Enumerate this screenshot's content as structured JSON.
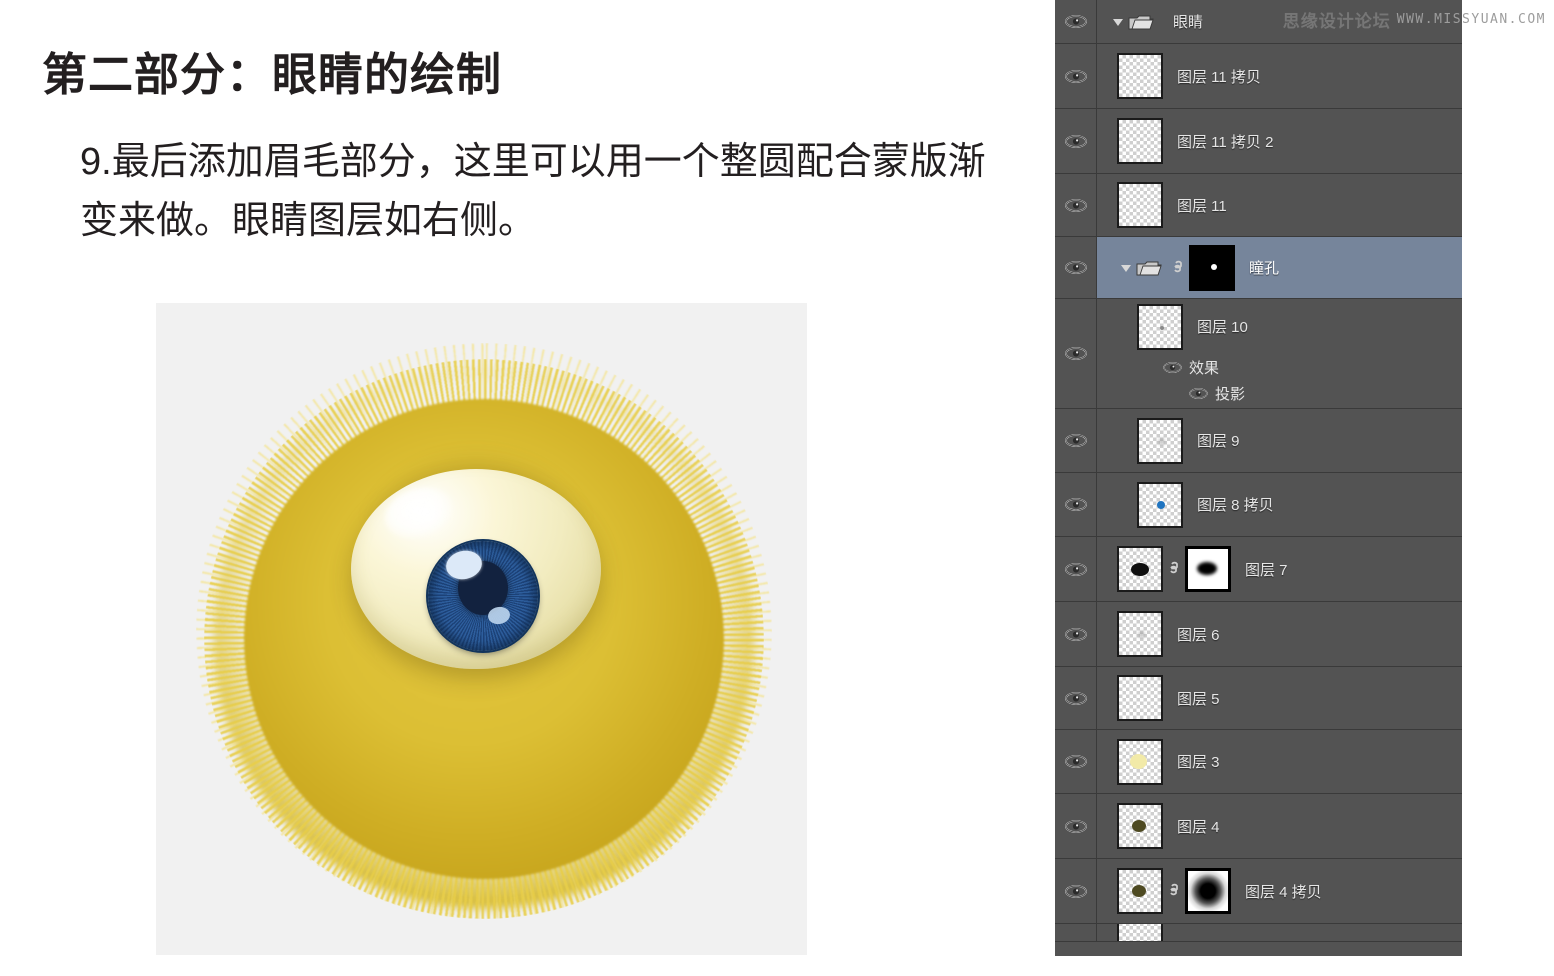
{
  "article": {
    "title": "第二部分：眼睛的绘制",
    "body": "9.最后添加眉毛部分，这里可以用一个整圆配合蒙版渐变来做。眼睛图层如右侧。"
  },
  "illustration": {
    "alt_name": "furry-yellow-eyeball",
    "background_color": "#f1f1f1",
    "fur_color": "#d6ba2e",
    "eyeball_color": "#f2ecc0",
    "iris_color": "#28558f",
    "pupil_color": "#12223f"
  },
  "watermark": {
    "cn": "思缘设计论坛",
    "url": "WWW.MISSYUAN.COM"
  },
  "panel": {
    "background_color": "#535353",
    "selected_color": "#76859b",
    "rows": [
      {
        "name": "眼睛",
        "type": "group",
        "selected": false,
        "expanded": true,
        "has_visibility": true,
        "thumb": "none",
        "mask": "none",
        "indent": 0
      },
      {
        "name": "图层 11 拷贝",
        "type": "layer",
        "selected": false,
        "has_visibility": true,
        "thumb": "empty",
        "mask": "none",
        "indent": 1
      },
      {
        "name": "图层 11 拷贝 2",
        "type": "layer",
        "selected": false,
        "has_visibility": true,
        "thumb": "empty",
        "mask": "none",
        "indent": 1
      },
      {
        "name": "图层 11",
        "type": "layer",
        "selected": false,
        "has_visibility": true,
        "thumb": "empty",
        "mask": "none",
        "indent": 1
      },
      {
        "name": "瞳孔",
        "type": "group",
        "selected": true,
        "expanded": true,
        "has_visibility": true,
        "thumb": "none",
        "mask": "black-dot",
        "linked": true,
        "indent": 1
      },
      {
        "name": "图层 10",
        "type": "layer",
        "selected": false,
        "has_visibility": true,
        "thumb": "tiny-dot",
        "mask": "none",
        "indent": 2,
        "effects": {
          "label": "效果",
          "items": [
            "投影"
          ]
        }
      },
      {
        "name": "图层 9",
        "type": "layer",
        "selected": false,
        "has_visibility": true,
        "thumb": "faint",
        "mask": "none",
        "indent": 2
      },
      {
        "name": "图层 8 拷贝",
        "type": "layer",
        "selected": false,
        "has_visibility": true,
        "thumb": "blue-dot",
        "mask": "none",
        "indent": 2
      },
      {
        "name": "图层 7",
        "type": "layer",
        "selected": false,
        "has_visibility": true,
        "thumb": "black-dot",
        "mask": "white-blob",
        "linked": true,
        "indent": 1
      },
      {
        "name": "图层 6",
        "type": "layer",
        "selected": false,
        "has_visibility": true,
        "thumb": "faint",
        "mask": "none",
        "indent": 1
      },
      {
        "name": "图层 5",
        "type": "layer",
        "selected": false,
        "has_visibility": true,
        "thumb": "empty",
        "mask": "none",
        "indent": 1
      },
      {
        "name": "图层 3",
        "type": "layer",
        "selected": false,
        "has_visibility": true,
        "thumb": "yellow-dot",
        "mask": "none",
        "indent": 1
      },
      {
        "name": "图层 4",
        "type": "layer",
        "selected": false,
        "has_visibility": true,
        "thumb": "olive-dot",
        "mask": "none",
        "indent": 1
      },
      {
        "name": "图层 4 拷贝",
        "type": "layer",
        "selected": false,
        "has_visibility": true,
        "thumb": "olive-dot",
        "mask": "radial-blob",
        "linked": true,
        "indent": 1
      }
    ],
    "partial_row": {
      "name": "",
      "thumb": "empty"
    }
  },
  "icons": {
    "visibility": "eye-icon",
    "folder": "folder-icon",
    "disclosure": "triangle-down-icon",
    "link": "link-icon"
  }
}
